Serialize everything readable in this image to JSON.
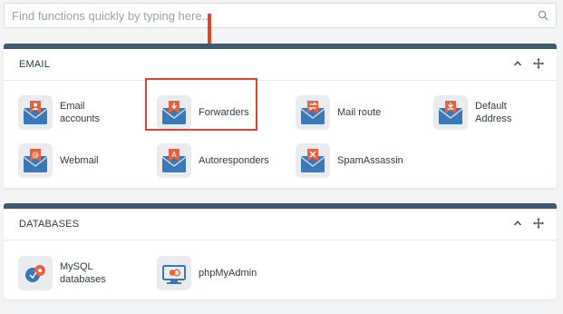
{
  "search": {
    "placeholder": "Find functions quickly by typing here...",
    "icon": "search-icon"
  },
  "email": {
    "title": "EMAIL",
    "items": [
      {
        "label": "Email\naccounts",
        "icon": "email-accounts-icon"
      },
      {
        "label": "Forwarders",
        "icon": "forwarders-icon"
      },
      {
        "label": "Mail route",
        "icon": "mail-route-icon"
      },
      {
        "label": "Default\nAddress",
        "icon": "default-address-icon"
      },
      {
        "label": "Webmail",
        "icon": "webmail-icon"
      },
      {
        "label": "Autoresponders",
        "icon": "autoresponders-icon"
      },
      {
        "label": "SpamAssassin",
        "icon": "spamassassin-icon"
      }
    ]
  },
  "databases": {
    "title": "DATABASES",
    "items": [
      {
        "label": "MySQL\ndatabases",
        "icon": "mysql-databases-icon"
      },
      {
        "label": "phpMyAdmin",
        "icon": "phpmyadmin-icon"
      }
    ]
  },
  "colors": {
    "panel_header_bar": "#3f5a6e",
    "icon_envelope_blue": "#3a78b8",
    "icon_badge_orange": "#e8603c",
    "highlight_red": "#e2442f"
  }
}
